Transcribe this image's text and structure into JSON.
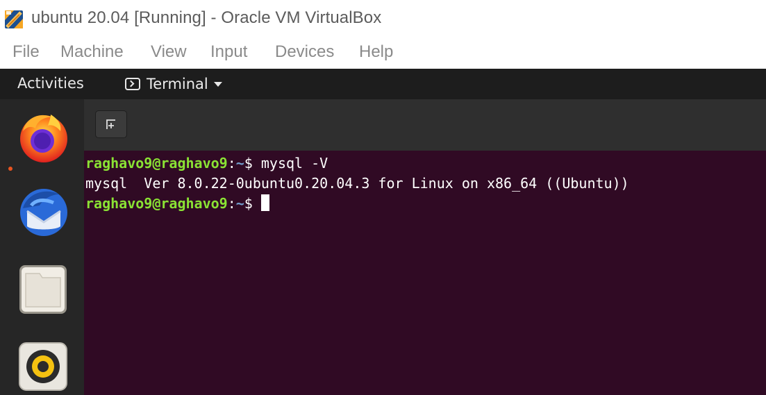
{
  "window": {
    "title": "ubuntu 20.04  [Running] - Oracle VM VirtualBox",
    "icon": "virtualbox-logo"
  },
  "menubar": {
    "items": [
      "File",
      "Machine",
      "View",
      "Input",
      "Devices",
      "Help"
    ]
  },
  "gnome_topbar": {
    "activities_label": "Activities",
    "app_menu_label": "Terminal",
    "app_menu_icon": "terminal-icon"
  },
  "dock": {
    "items": [
      {
        "name": "firefox",
        "icon": "firefox-icon",
        "running": true
      },
      {
        "name": "thunderbird",
        "icon": "thunderbird-icon",
        "running": false
      },
      {
        "name": "files",
        "icon": "files-icon",
        "running": false
      },
      {
        "name": "rhythmbox",
        "icon": "rhythmbox-icon",
        "running": false
      }
    ]
  },
  "terminal": {
    "new_tab_icon": "new-tab-icon",
    "lines": [
      {
        "user": "raghavo9@raghavo9",
        "path": "~",
        "sign": "$",
        "command": " mysql -V"
      },
      {
        "output": "mysql  Ver 8.0.22-0ubuntu0.20.04.3 for Linux on x86_64 ((Ubuntu))"
      },
      {
        "user": "raghavo9@raghavo9",
        "path": "~",
        "sign": "$",
        "command": " "
      }
    ],
    "colors": {
      "background": "#300a24",
      "prompt_user": "#8ae234",
      "prompt_path": "#729fcf"
    }
  }
}
